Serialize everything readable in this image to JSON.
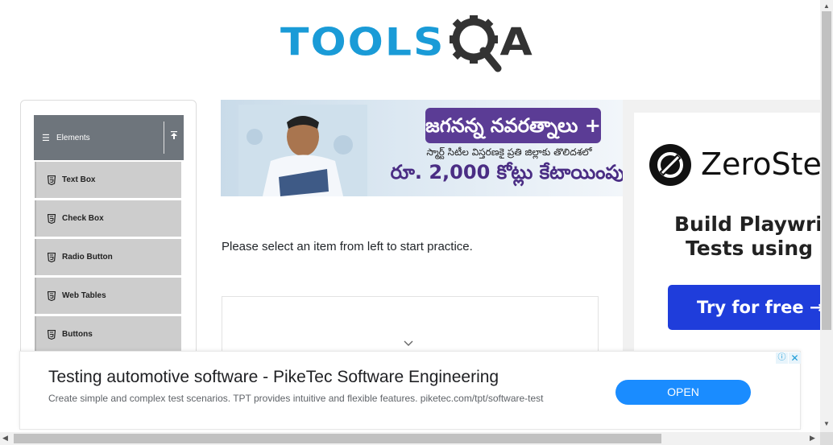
{
  "header": {
    "logo_tools": "TOOLS",
    "logo_q_icon": "gear-magnifier-icon",
    "logo_a": "A",
    "colors": {
      "tools": "#1a9bd7",
      "qa": "#333333"
    }
  },
  "sidebar": {
    "group_label": "Elements",
    "group_color": "#6e757c",
    "items": [
      {
        "label": "Text Box",
        "icon": "html5-icon"
      },
      {
        "label": "Check Box",
        "icon": "html5-icon"
      },
      {
        "label": "Radio Button",
        "icon": "html5-icon"
      },
      {
        "label": "Web Tables",
        "icon": "html5-icon"
      },
      {
        "label": "Buttons",
        "icon": "html5-icon"
      }
    ]
  },
  "banner_ad": {
    "headline": "జగనన్న నవరత్నాలు +",
    "subline": "స్మార్ట్ సిటీల విస్తరణకై ప్రతి జిల్లాకు తొలిదశలో",
    "amount": "రూ. 2,000 కోట్లు కేటాయింపు",
    "accent": "#5b3c95"
  },
  "right_ad": {
    "brand": "ZeroStep",
    "line1": "Build Playwright",
    "line2": "Tests using AI",
    "button": "Try for free →",
    "button_color": "#1f3ddb"
  },
  "main": {
    "instruction": "Please select an item from left to start practice."
  },
  "bottom_ad": {
    "title": "Testing automotive software - PikeTec Software Engineering",
    "description": "Create simple and complex test scenarios. TPT provides intuitive and flexible features. piketec.com/tpt/software-test",
    "open_label": "OPEN",
    "adchoices_symbol": "ⓘ",
    "close_symbol": "✕",
    "button_color": "#1a8cff"
  }
}
